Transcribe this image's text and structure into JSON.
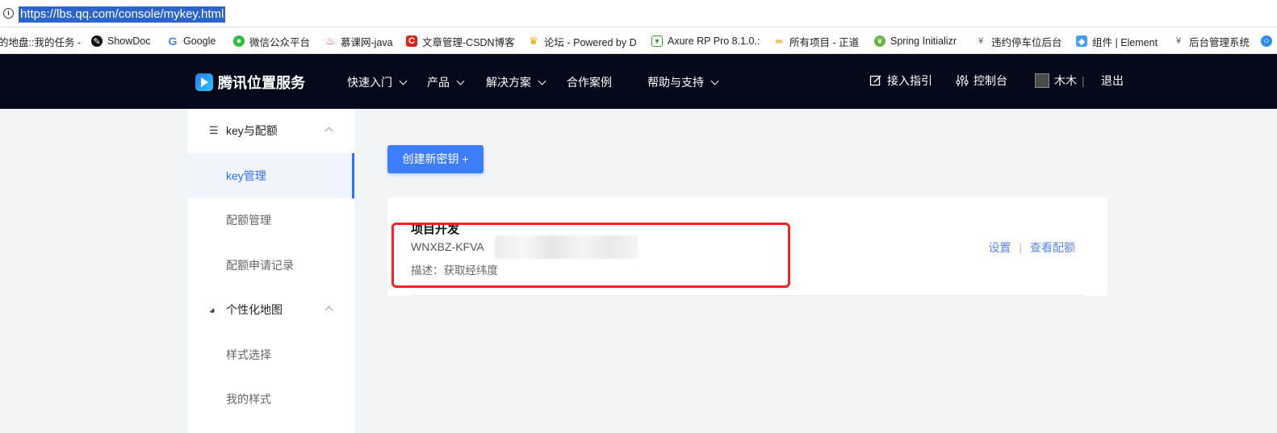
{
  "browser": {
    "url": "https://lbs.qq.com/console/mykey.html",
    "bookmarks": [
      {
        "label": "的地盘::我的任务 -",
        "icon": "none",
        "color": "#555555"
      },
      {
        "label": "ShowDoc",
        "icon": "showdoc-icon",
        "color": "#111111"
      },
      {
        "label": "Google",
        "icon": "google-icon",
        "color": "#4285f4"
      },
      {
        "label": "微信公众平台",
        "icon": "wechat-icon",
        "color": "#27c03a"
      },
      {
        "label": "慕课网-java",
        "icon": "flame-icon",
        "color": "#f24a2f"
      },
      {
        "label": "文章管理-CSDN博客",
        "icon": "csdn-icon",
        "color": "#d9251d"
      },
      {
        "label": "论坛 - Powered by D",
        "icon": "trophy-icon",
        "color": "#e8a500"
      },
      {
        "label": "Axure RP Pro 8.1.0.:",
        "icon": "axure-icon",
        "color": "#37a02c"
      },
      {
        "label": "所有项目 - 正道",
        "icon": "link-icon",
        "color": "#e39a00"
      },
      {
        "label": "Spring Initializr",
        "icon": "spring-icon",
        "color": "#6db33f"
      },
      {
        "label": "违约停车位后台",
        "icon": "yen-icon",
        "color": "#555555"
      },
      {
        "label": "组件 | Element",
        "icon": "element-icon",
        "color": "#409eff"
      },
      {
        "label": "后台管理系统",
        "icon": "yen-icon",
        "color": "#555555"
      }
    ]
  },
  "header": {
    "brand": "腾讯位置服务",
    "nav": [
      {
        "label": "快速入门",
        "dropdown": true
      },
      {
        "label": "产品",
        "dropdown": true
      },
      {
        "label": "解决方案",
        "dropdown": true
      },
      {
        "label": "合作案例",
        "dropdown": false
      },
      {
        "label": "帮助与支持",
        "dropdown": true
      }
    ],
    "guide": "接入指引",
    "console": "控制台",
    "user": "木木",
    "logout": "退出"
  },
  "sidebar": {
    "groups": [
      {
        "label": "key与配额",
        "icon": "list-icon",
        "items": [
          "key管理",
          "配额管理",
          "配额申请记录"
        ]
      },
      {
        "label": "个性化地图",
        "icon": "palette-icon",
        "items": [
          "样式选择",
          "我的样式"
        ]
      }
    ],
    "active": "key管理"
  },
  "main": {
    "create_button": "创建新密钥 +",
    "key_card": {
      "title": "项目开发",
      "key_visible": "WNXBZ-KFVA",
      "description": "描述：获取经纬度",
      "settings": "设置",
      "view_quota": "查看配额"
    }
  },
  "colors": {
    "accent": "#3d7dff",
    "nav_bg": "#050a1a",
    "highlight": "#ff2020",
    "link": "#5b86e5"
  }
}
